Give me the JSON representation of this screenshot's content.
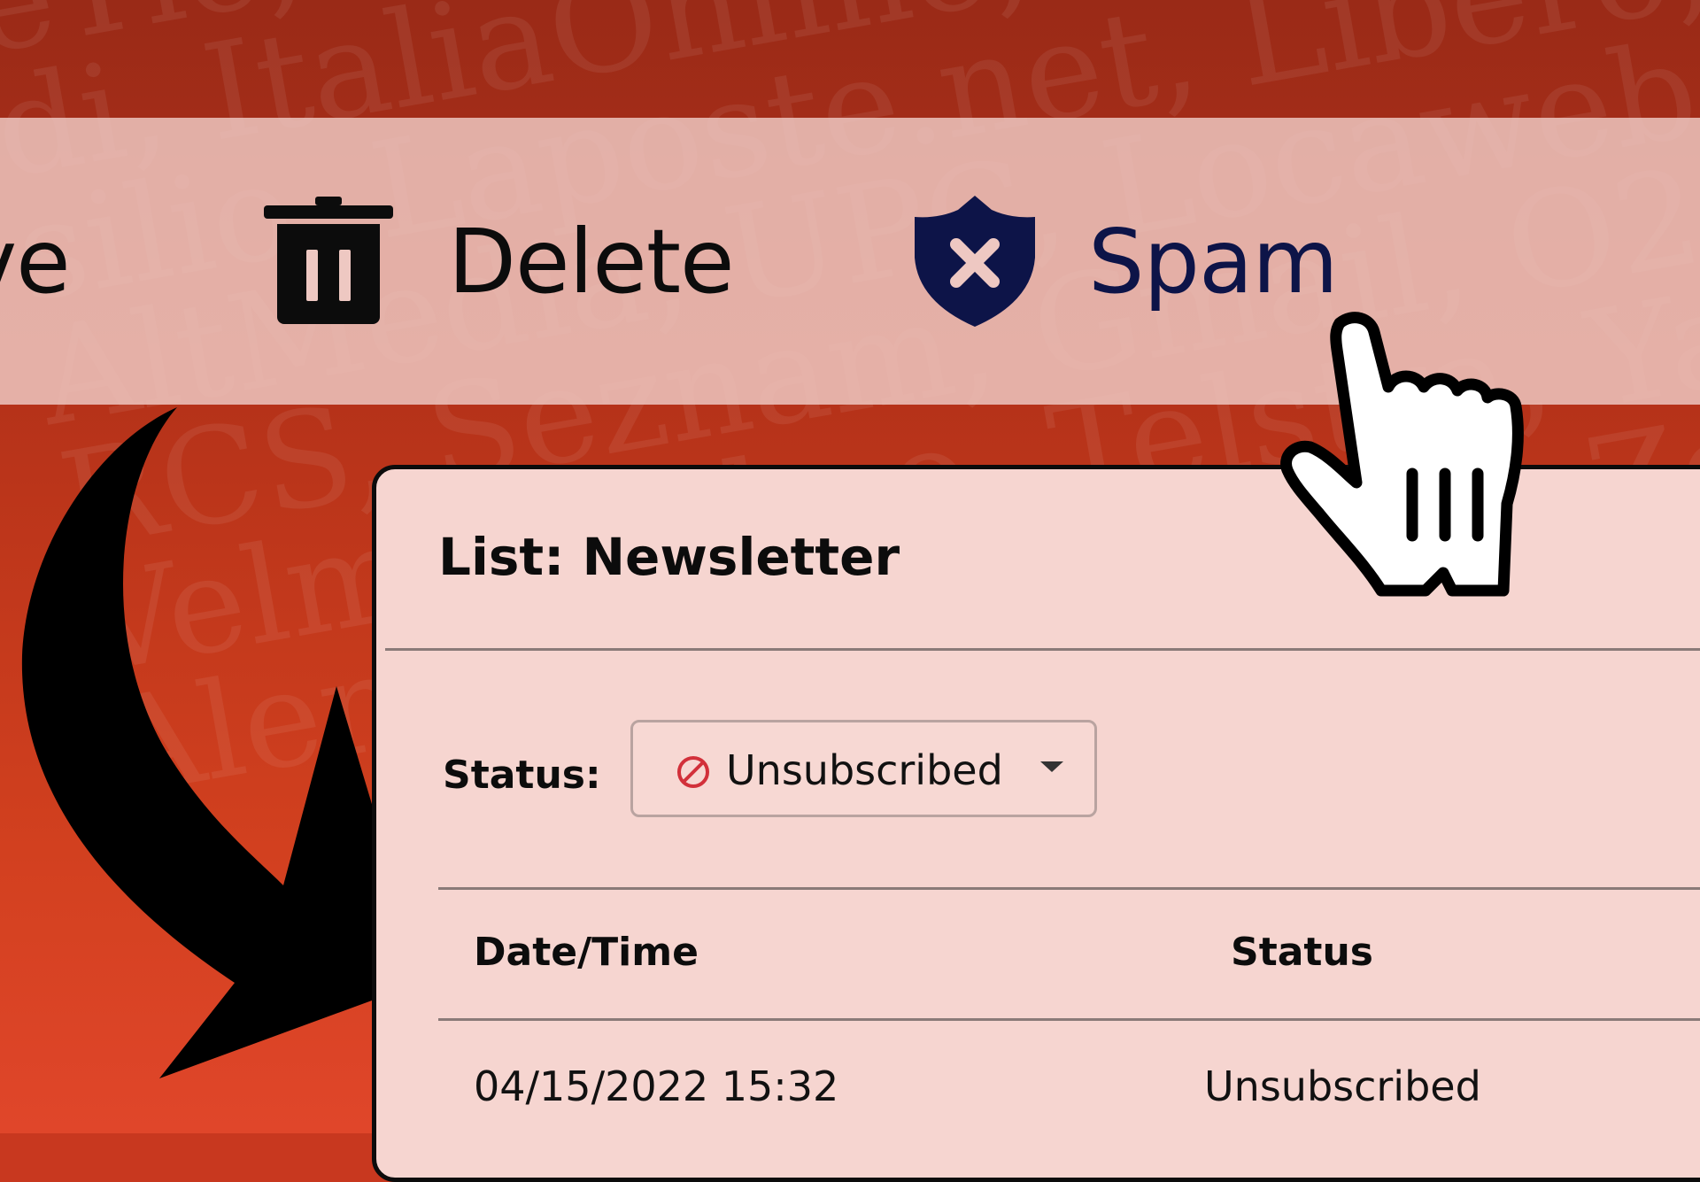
{
  "toolbar": {
    "archive_label": "ve",
    "delete_label": "Delete",
    "spam_label": "Spam"
  },
  "panel": {
    "title": "List: Newsletter",
    "status_filter_label": "Status:",
    "status_filter_value": "Unsubscribed",
    "table": {
      "columns": [
        "Date/Time",
        "Status"
      ],
      "rows": [
        [
          "04/15/2022 15:32",
          "Unsubscribed"
        ]
      ]
    }
  },
  "background_text": "eTie, Comcast, Fastmail,\ndi, ItaliaOnline, LiberoMail, G\nsilio, Laposte.net, Libero, Global\nAltMedia, UPC, Locaweb, Mail.r\nRCS, Seznam, Gmail, O2, Bell\nVelmo, Yahoo, Telstra, Yandex\nAlenco, Web.de, Mail, Zoho",
  "colors": {
    "background": "#c8381f",
    "toolbar": "#eec8c2",
    "panel": "#f6d5d0",
    "spam_accent": "#0d1448",
    "unsubscribed_icon": "#d2303a"
  },
  "icons": {
    "delete": "trash-icon",
    "spam": "shield-x-icon",
    "status": "no-entry-icon",
    "dropdown": "chevron-down-icon"
  }
}
